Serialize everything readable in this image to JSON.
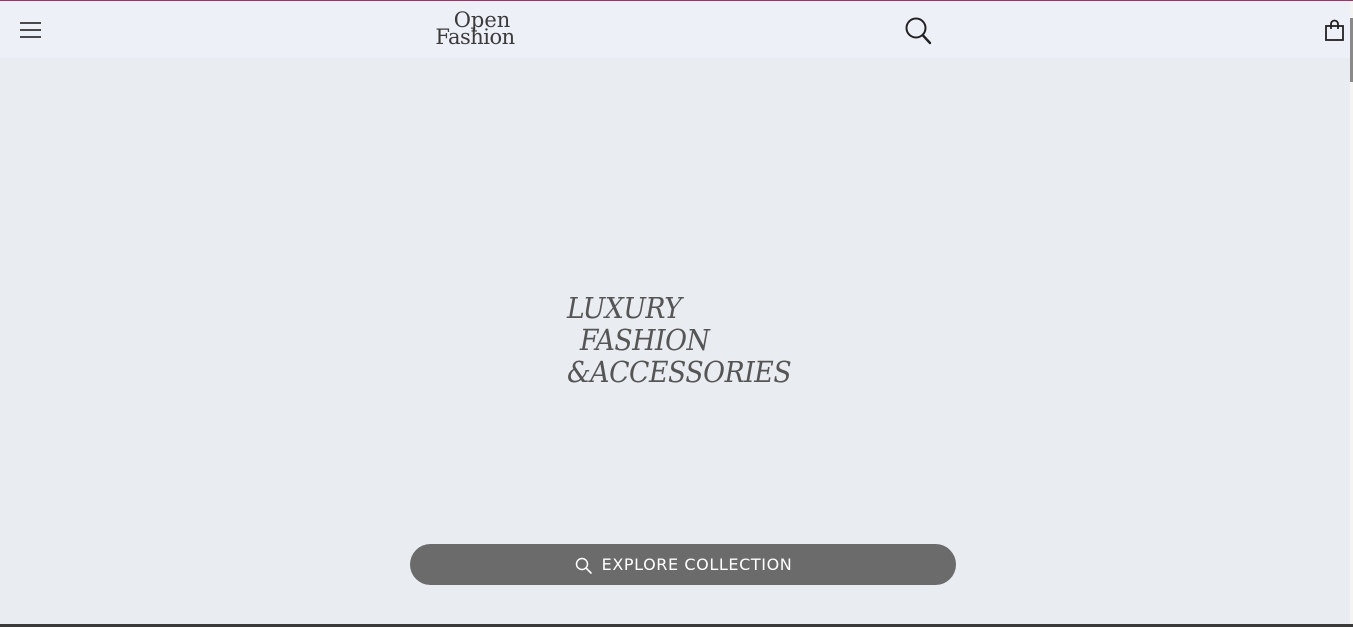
{
  "header": {
    "logo_line1": "Open",
    "logo_line2": "Fashion",
    "menu_icon": "hamburger-menu-icon",
    "search_icon": "search-icon",
    "bag_icon": "shopping-bag-icon"
  },
  "hero": {
    "title_line1": "LUXURY",
    "title_line2": "FASHION",
    "title_line3": "&ACCESSORIES",
    "cta_label": "EXPLORE COLLECTION",
    "cta_icon": "search-icon"
  },
  "colors": {
    "accent_line": "#a4306a",
    "header_bg": "#edf0f7",
    "page_bg": "#e9ecf1",
    "button_bg": "#6b6b6c",
    "title_text": "#555555"
  }
}
